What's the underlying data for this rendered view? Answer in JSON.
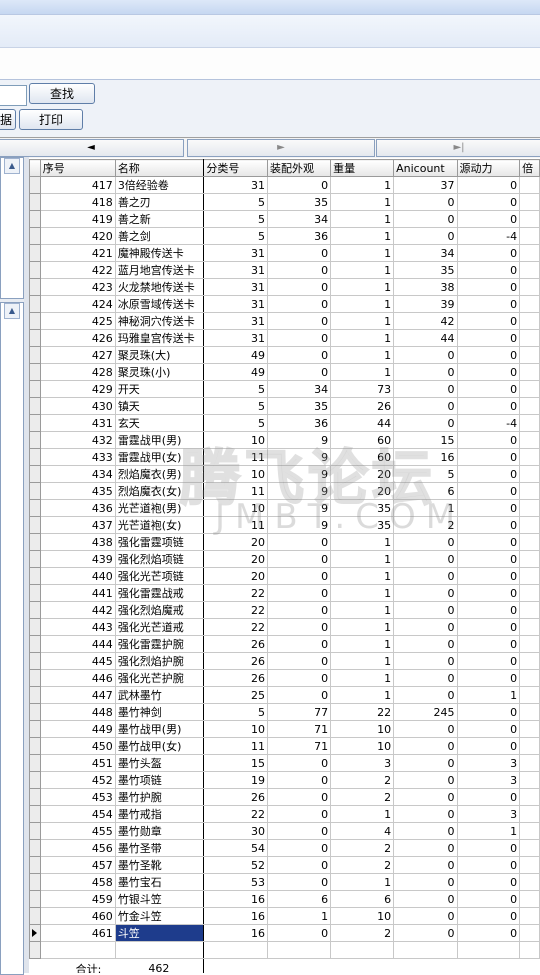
{
  "toolbar": {
    "search_value": "",
    "find_label": "查找",
    "data_label": "据",
    "print_label": "打印"
  },
  "nav": {
    "prev_glyph": "◄",
    "next_glyph": "►",
    "last_glyph": "►|"
  },
  "left": {
    "scroll_up_glyph": "▲"
  },
  "table": {
    "columns": [
      "序号",
      "名称",
      "分类号",
      "装配外观",
      "重量",
      "Anicount",
      "源动力",
      "倍"
    ],
    "rows": [
      [
        "417",
        "3倍经验卷",
        "31",
        "0",
        "1",
        "37",
        "0"
      ],
      [
        "418",
        "善之刃",
        "5",
        "35",
        "1",
        "0",
        "0"
      ],
      [
        "419",
        "善之新",
        "5",
        "34",
        "1",
        "0",
        "0"
      ],
      [
        "420",
        "善之剑",
        "5",
        "36",
        "1",
        "0",
        "-4"
      ],
      [
        "421",
        "魔神殿传送卡",
        "31",
        "0",
        "1",
        "34",
        "0"
      ],
      [
        "422",
        "蓝月地宫传送卡",
        "31",
        "0",
        "1",
        "35",
        "0"
      ],
      [
        "423",
        "火龙禁地传送卡",
        "31",
        "0",
        "1",
        "38",
        "0"
      ],
      [
        "424",
        "冰原雪域传送卡",
        "31",
        "0",
        "1",
        "39",
        "0"
      ],
      [
        "425",
        "神秘洞穴传送卡",
        "31",
        "0",
        "1",
        "42",
        "0"
      ],
      [
        "426",
        "玛雅皇宫传送卡",
        "31",
        "0",
        "1",
        "44",
        "0"
      ],
      [
        "427",
        "聚灵珠(大)",
        "49",
        "0",
        "1",
        "0",
        "0"
      ],
      [
        "428",
        "聚灵珠(小)",
        "49",
        "0",
        "1",
        "0",
        "0"
      ],
      [
        "429",
        "开天",
        "5",
        "34",
        "73",
        "0",
        "0"
      ],
      [
        "430",
        "镇天",
        "5",
        "35",
        "26",
        "0",
        "0"
      ],
      [
        "431",
        "玄天",
        "5",
        "36",
        "44",
        "0",
        "-4"
      ],
      [
        "432",
        "雷霆战甲(男)",
        "10",
        "9",
        "60",
        "15",
        "0"
      ],
      [
        "433",
        "雷霆战甲(女)",
        "11",
        "9",
        "60",
        "16",
        "0"
      ],
      [
        "434",
        "烈焰魔衣(男)",
        "10",
        "9",
        "20",
        "5",
        "0"
      ],
      [
        "435",
        "烈焰魔衣(女)",
        "11",
        "9",
        "20",
        "6",
        "0"
      ],
      [
        "436",
        "光芒道袍(男)",
        "10",
        "9",
        "35",
        "1",
        "0"
      ],
      [
        "437",
        "光芒道袍(女)",
        "11",
        "9",
        "35",
        "2",
        "0"
      ],
      [
        "438",
        "强化雷霆项链",
        "20",
        "0",
        "1",
        "0",
        "0"
      ],
      [
        "439",
        "强化烈焰项链",
        "20",
        "0",
        "1",
        "0",
        "0"
      ],
      [
        "440",
        "强化光芒项链",
        "20",
        "0",
        "1",
        "0",
        "0"
      ],
      [
        "441",
        "强化雷霆战戒",
        "22",
        "0",
        "1",
        "0",
        "0"
      ],
      [
        "442",
        "强化烈焰魔戒",
        "22",
        "0",
        "1",
        "0",
        "0"
      ],
      [
        "443",
        "强化光芒道戒",
        "22",
        "0",
        "1",
        "0",
        "0"
      ],
      [
        "444",
        "强化雷霆护腕",
        "26",
        "0",
        "1",
        "0",
        "0"
      ],
      [
        "445",
        "强化烈焰护腕",
        "26",
        "0",
        "1",
        "0",
        "0"
      ],
      [
        "446",
        "强化光芒护腕",
        "26",
        "0",
        "1",
        "0",
        "0"
      ],
      [
        "447",
        "武林墨竹",
        "25",
        "0",
        "1",
        "0",
        "1"
      ],
      [
        "448",
        "墨竹神剑",
        "5",
        "77",
        "22",
        "245",
        "0"
      ],
      [
        "449",
        "墨竹战甲(男)",
        "10",
        "71",
        "10",
        "0",
        "0"
      ],
      [
        "450",
        "墨竹战甲(女)",
        "11",
        "71",
        "10",
        "0",
        "0"
      ],
      [
        "451",
        "墨竹头盔",
        "15",
        "0",
        "3",
        "0",
        "3"
      ],
      [
        "452",
        "墨竹项链",
        "19",
        "0",
        "2",
        "0",
        "3"
      ],
      [
        "453",
        "墨竹护腕",
        "26",
        "0",
        "2",
        "0",
        "0"
      ],
      [
        "454",
        "墨竹戒指",
        "22",
        "0",
        "1",
        "0",
        "3"
      ],
      [
        "455",
        "墨竹勋章",
        "30",
        "0",
        "4",
        "0",
        "1"
      ],
      [
        "456",
        "墨竹圣带",
        "54",
        "0",
        "2",
        "0",
        "0"
      ],
      [
        "457",
        "墨竹圣靴",
        "52",
        "0",
        "2",
        "0",
        "0"
      ],
      [
        "458",
        "墨竹宝石",
        "53",
        "0",
        "1",
        "0",
        "0"
      ],
      [
        "459",
        "竹银斗笠",
        "16",
        "6",
        "6",
        "0",
        "0"
      ],
      [
        "460",
        "竹金斗笠",
        "16",
        "1",
        "10",
        "0",
        "0"
      ],
      [
        "461",
        "斗笠",
        "16",
        "0",
        "2",
        "0",
        "0"
      ]
    ],
    "selected_index": 44,
    "footer_label": "合计:",
    "footer_count": "462"
  },
  "watermark": {
    "main": "腾飞论坛",
    "sub": "JMBT.COM"
  }
}
